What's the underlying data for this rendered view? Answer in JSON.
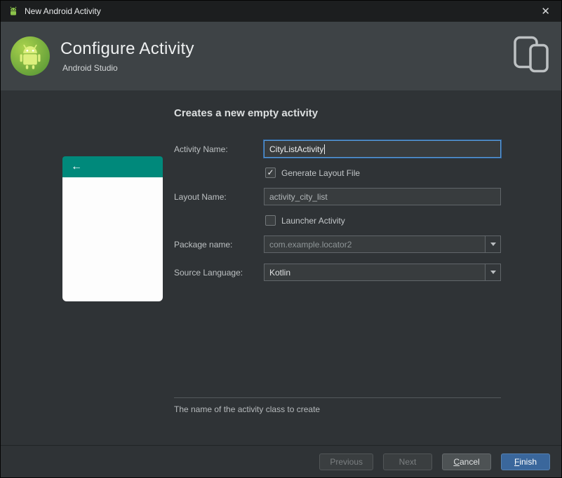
{
  "window": {
    "title": "New Android Activity",
    "close_glyph": "✕"
  },
  "header": {
    "title": "Configure Activity",
    "subtitle": "Android Studio"
  },
  "main": {
    "heading": "Creates a new empty activity",
    "help_text": "The name of the activity class to create"
  },
  "form": {
    "activity_name": {
      "label": "Activity Name:",
      "value": "CityListActivity"
    },
    "generate_layout_file": {
      "label": "Generate Layout File",
      "checked": true
    },
    "layout_name": {
      "label": "Layout Name:",
      "value": "activity_city_list"
    },
    "launcher_activity": {
      "label": "Launcher Activity",
      "checked": false
    },
    "package_name": {
      "label": "Package name:",
      "value": "com.example.locator2"
    },
    "source_language": {
      "label": "Source Language:",
      "value": "Kotlin"
    }
  },
  "icons": {
    "back_arrow": "←",
    "check": "✓"
  },
  "footer": {
    "previous": "Previous",
    "next": "Next",
    "cancel": "Cancel",
    "finish": "Finish"
  },
  "colors": {
    "titlebar_bg": "#1c1e1f",
    "header_bg": "#3e4346",
    "body_bg": "#2f3336",
    "field_bg": "#383c3e",
    "field_border": "#61666a",
    "focus_blue": "#5a9bd8",
    "teal_header": "#00897b",
    "primary_button": "#3a679c"
  }
}
